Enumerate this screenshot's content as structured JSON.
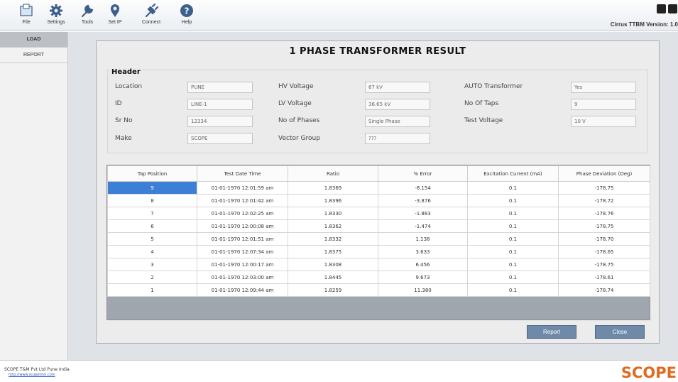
{
  "toolbar": {
    "items": [
      {
        "label": "File",
        "icon": "folder-icon"
      },
      {
        "label": "Settings",
        "icon": "gear-icon"
      },
      {
        "label": "Tools",
        "icon": "wrench-icon"
      },
      {
        "label": "Set IP",
        "icon": "location-pin-icon"
      },
      {
        "label": "Connect",
        "icon": "plug-icon"
      },
      {
        "label": "Help",
        "icon": "help-icon"
      }
    ],
    "version_text": "Cirrus TTBM Version: 1.0"
  },
  "sidebar": {
    "tabs": [
      {
        "label": "LOAD",
        "active": true
      },
      {
        "label": "REPORT",
        "active": false
      }
    ]
  },
  "dialog": {
    "title": "1 PHASE TRANSFORMER RESULT",
    "header_legend": "Header",
    "fields": {
      "location": {
        "label": "Location",
        "value": "PUNE"
      },
      "id": {
        "label": "ID",
        "value": "LINE-1"
      },
      "sr_no": {
        "label": "Sr No",
        "value": "12334"
      },
      "make": {
        "label": "Make",
        "value": "SCOPE"
      },
      "hv_voltage": {
        "label": "HV Voltage",
        "value": "67 kV"
      },
      "lv_voltage": {
        "label": "LV Voltage",
        "value": "36.65 kV"
      },
      "no_of_phases": {
        "label": "No of Phases",
        "value": "Single Phase"
      },
      "vector_group": {
        "label": "Vector Group",
        "value": "???"
      },
      "auto_transformer": {
        "label": "AUTO Transformer",
        "value": "Yes"
      },
      "no_of_taps": {
        "label": "No Of Taps",
        "value": "9"
      },
      "test_voltage": {
        "label": "Test Voltage",
        "value": "10 V"
      }
    },
    "table": {
      "columns": [
        "Tap Position",
        "Test Date Time",
        "Ratio",
        "% Error",
        "Excitation Current (mA)",
        "Phase Deviation (Deg)"
      ],
      "rows": [
        [
          "9",
          "01-01-1970 12:01:59 am",
          "1.8369",
          "-8.154",
          "0.1",
          "-178.75"
        ],
        [
          "8",
          "01-01-1970 12:01:42 am",
          "1.8396",
          "-3.876",
          "0.1",
          "-178.72"
        ],
        [
          "7",
          "01-01-1970 12:02:25 am",
          "1.8330",
          "-1.883",
          "0.1",
          "-178.76"
        ],
        [
          "6",
          "01-01-1970 12:00:08 am",
          "1.8362",
          "-1.474",
          "0.1",
          "-178.75"
        ],
        [
          "5",
          "01-01-1970 12:01:51 am",
          "1.8332",
          "1.138",
          "0.1",
          "-178.70"
        ],
        [
          "4",
          "01-01-1970 12:07:34 am",
          "1.8375",
          "3.633",
          "0.1",
          "-178.65"
        ],
        [
          "3",
          "01-01-1970 12:00:17 am",
          "1.8308",
          "6.456",
          "0.1",
          "-178.75"
        ],
        [
          "2",
          "01-01-1970 12:03:00 am",
          "1.8445",
          "9.673",
          "0.1",
          "-178.61"
        ],
        [
          "1",
          "01-01-1970 12:09:44 am",
          "1.8259",
          "11.380",
          "0.1",
          "-178.74"
        ]
      ],
      "selected_row": 0
    },
    "buttons": {
      "report": "Report",
      "close": "Close"
    }
  },
  "footer": {
    "company": "SCOPE T&M Pvt Ltd Pune India",
    "link": "http://www.scopetnm.com",
    "logo": "SCOPE"
  },
  "colors": {
    "accent": "#3c7fd6",
    "button": "#6f8aa8",
    "logo": "#e06a1e"
  }
}
